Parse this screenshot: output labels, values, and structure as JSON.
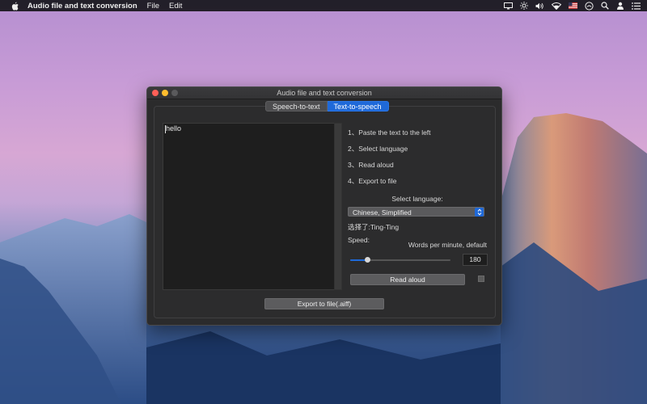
{
  "menubar": {
    "app_name": "Audio file and text conversion",
    "menus": [
      "File",
      "Edit"
    ],
    "status_icons": [
      "display-icon",
      "brightness-icon",
      "volume-icon",
      "wifi-icon",
      "us-flag-icon",
      "clock-icon",
      "search-icon",
      "user-icon",
      "list-icon"
    ]
  },
  "window": {
    "title": "Audio file and text conversion",
    "tabs": [
      {
        "label": "Speech-to-text",
        "active": false
      },
      {
        "label": "Text-to-speech",
        "active": true
      }
    ],
    "text_content": "hello",
    "steps": [
      "1、Paste the text to the left",
      "2、Select language",
      "3、Read aloud",
      "4、Export to file"
    ],
    "select_language_label": "Select language:",
    "language_selected": "Chinese, Simplified",
    "chosen_voice": "选择了:Ting-Ting",
    "speed_label": "Speed:",
    "wpm_label": "Words per minute, default",
    "speed_fraction": 0.17,
    "wpm_value": "180",
    "read_aloud_label": "Read aloud",
    "export_label": "Export to file(.aiff)"
  },
  "colors": {
    "accent": "#1f69d8",
    "window_bg": "#2b2b2c",
    "close": "#fe5f57",
    "minimize": "#febc2e"
  }
}
